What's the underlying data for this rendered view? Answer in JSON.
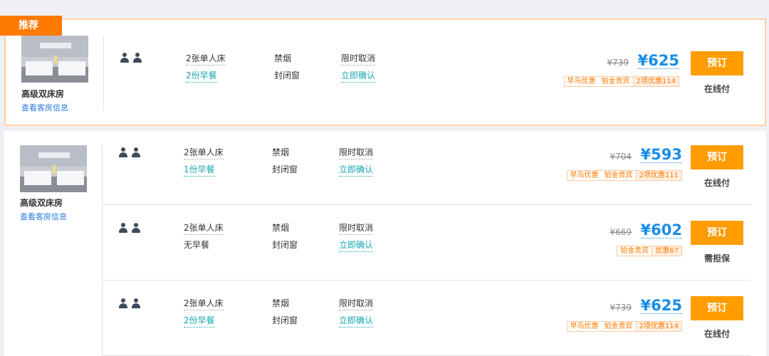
{
  "recommend_tag": "推荐",
  "colors": {
    "accent_orange": "#ff9c00",
    "price_blue": "#1a8de6",
    "link_blue": "#2577e3",
    "teal": "#16a6b0",
    "highlight_border": "#ffd2a3"
  },
  "groups": [
    {
      "room_name": "高级双床房",
      "room_info_link": "查看客房信息",
      "plans": [
        {
          "bed": "2张单人床",
          "breakfast": "2份早餐",
          "smoking": "禁烟",
          "window": "封闭窗",
          "cancel": "限时取消",
          "confirm": "立即确认",
          "orig_price": "¥739",
          "price": "¥625",
          "promos": [
            "早鸟优惠",
            "铂金贵宾"
          ],
          "promo_sum": "2项优惠114",
          "book": "预订",
          "pay": "在线付"
        }
      ]
    },
    {
      "room_name": "高级双床房",
      "room_info_link": "查看客房信息",
      "plans": [
        {
          "bed": "2张单人床",
          "breakfast": "1份早餐",
          "smoking": "禁烟",
          "window": "封闭窗",
          "cancel": "限时取消",
          "confirm": "立即确认",
          "orig_price": "¥704",
          "price": "¥593",
          "promos": [
            "早鸟优惠",
            "铂金贵宾"
          ],
          "promo_sum": "2项优惠111",
          "book": "预订",
          "pay": "在线付"
        },
        {
          "bed": "2张单人床",
          "breakfast": "无早餐",
          "smoking": "禁烟",
          "window": "封闭窗",
          "cancel": "限时取消",
          "confirm": "立即确认",
          "orig_price": "¥669",
          "price": "¥602",
          "promos": [
            "铂金贵宾"
          ],
          "promo_sum": "优惠67",
          "book": "预订",
          "pay": "需担保"
        },
        {
          "bed": "2张单人床",
          "breakfast": "2份早餐",
          "smoking": "禁烟",
          "window": "封闭窗",
          "cancel": "限时取消",
          "confirm": "立即确认",
          "orig_price": "¥739",
          "price": "¥625",
          "promos": [
            "早鸟优惠",
            "铂金贵宾"
          ],
          "promo_sum": "2项优惠114",
          "book": "预订",
          "pay": "在线付"
        }
      ]
    }
  ]
}
